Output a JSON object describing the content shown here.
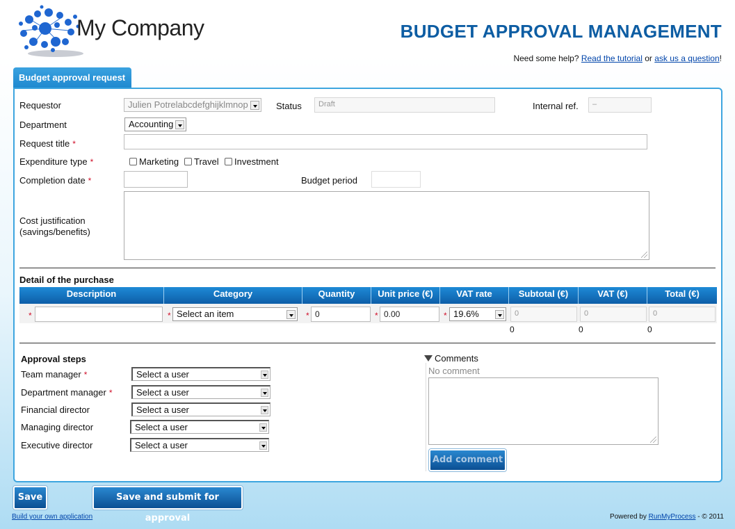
{
  "header": {
    "company_name": "My Company",
    "page_title": "BUDGET APPROVAL MANAGEMENT",
    "help_prefix": "Need some help? ",
    "help_link_tutorial": "Read the tutorial",
    "help_mid": " or ",
    "help_link_question": "ask us a question",
    "help_suffix": "!"
  },
  "tab": {
    "label": "Budget approval request"
  },
  "form": {
    "requestor": {
      "label": "Requestor",
      "value": "Julien Potrelabcdefghijklmnop"
    },
    "status": {
      "label": "Status",
      "value": "Draft"
    },
    "internal_ref": {
      "label": "Internal ref.",
      "value": "–"
    },
    "department": {
      "label": "Department",
      "value": "Accounting"
    },
    "request_title": {
      "label": "Request title",
      "required": "*",
      "value": ""
    },
    "expenditure_type": {
      "label": "Expenditure type",
      "required": "*",
      "options": [
        "Marketing",
        "Travel",
        "Investment"
      ]
    },
    "completion_date": {
      "label": "Completion date",
      "required": "*",
      "value": ""
    },
    "budget_period": {
      "label": "Budget period",
      "value": ""
    },
    "cost_justification": {
      "label_line1": "Cost justification",
      "label_line2": "(savings/benefits)",
      "value": ""
    }
  },
  "purchase": {
    "section_title": "Detail of the purchase",
    "columns": [
      "Description",
      "Category",
      "Quantity",
      "Unit price (€)",
      "VAT rate",
      "Subtotal (€)",
      "VAT (€)",
      "Total (€)"
    ],
    "row": {
      "required": "*",
      "description": "",
      "category": "Select an item",
      "quantity": "0",
      "unit_price": "0.00",
      "vat_rate": "19.6%",
      "subtotal": "0",
      "vat": "0",
      "total": "0"
    },
    "totals": {
      "subtotal": "0",
      "vat": "0",
      "total": "0"
    }
  },
  "approval": {
    "section_title": "Approval steps",
    "steps": [
      {
        "label": "Team manager",
        "required": "*",
        "value": "Select a user"
      },
      {
        "label": "Department manager",
        "required": "*",
        "value": "Select a user"
      },
      {
        "label": "Financial director",
        "required": "",
        "value": "Select a user"
      },
      {
        "label": "Managing director",
        "required": "",
        "value": "Select a user"
      },
      {
        "label": "Executive director",
        "required": "",
        "value": "Select a user"
      }
    ]
  },
  "comments": {
    "title": "Comments",
    "empty_text": "No comment",
    "add_button": "Add comment"
  },
  "actions": {
    "save": "Save",
    "save_submit": "Save and submit for approval"
  },
  "footer": {
    "build_link": "Build your own application",
    "powered_prefix": "Powered by ",
    "powered_link": "RunMyProcess",
    "powered_suffix": " - © 2011"
  },
  "colors": {
    "brand_blue": "#0d5da3",
    "accent_blue": "#1e88cf",
    "required_red": "#d0102a"
  }
}
